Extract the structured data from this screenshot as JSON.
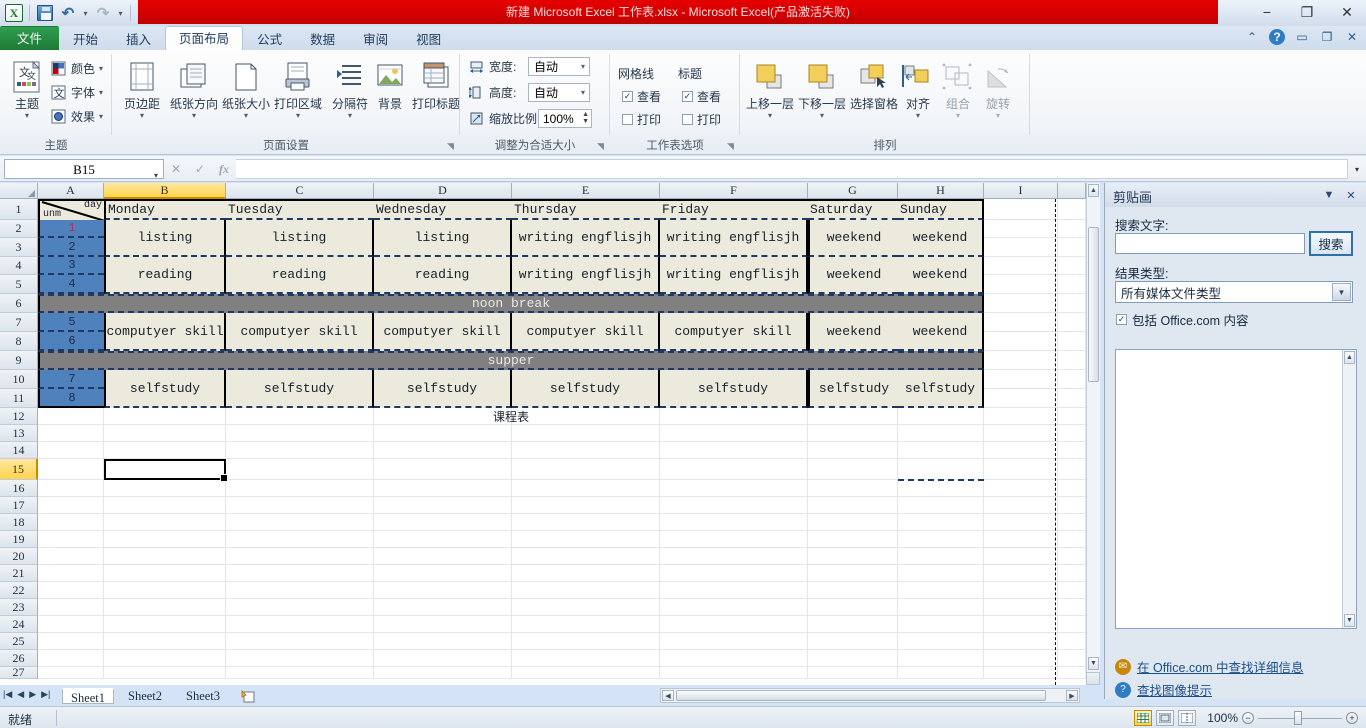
{
  "window": {
    "title": "新建 Microsoft Excel 工作表.xlsx - Microsoft Excel(产品激活失败)",
    "minimize": "−",
    "maximize": "❐",
    "close": "✕"
  },
  "quick_access": {
    "logo": "X",
    "save": "save-icon",
    "undo": "↶",
    "redo": "↷",
    "customize": "▾"
  },
  "tabs": [
    {
      "label": "文件",
      "active": false,
      "file": true
    },
    {
      "label": "开始",
      "active": false
    },
    {
      "label": "插入",
      "active": false
    },
    {
      "label": "页面布局",
      "active": true
    },
    {
      "label": "公式",
      "active": false
    },
    {
      "label": "数据",
      "active": false
    },
    {
      "label": "审阅",
      "active": false
    },
    {
      "label": "视图",
      "active": false
    }
  ],
  "ribbon": {
    "groups": [
      {
        "name": "主题"
      },
      {
        "name": "页面设置"
      },
      {
        "name": "调整为合适大小"
      },
      {
        "name": "工作表选项"
      },
      {
        "name": "排列"
      }
    ],
    "themes": {
      "theme_label": "主题",
      "colors_label": "颜色",
      "fonts_label": "字体",
      "effects_label": "效果"
    },
    "page_setup": [
      {
        "label": "页边距",
        "caret": "▾"
      },
      {
        "label": "纸张方向",
        "caret": "▾"
      },
      {
        "label": "纸张大小",
        "caret": "▾"
      },
      {
        "label": "打印区域",
        "caret": "▾"
      },
      {
        "label": "分隔符",
        "caret": "▾"
      },
      {
        "label": "背景",
        "caret": ""
      },
      {
        "label": "打印标题",
        "caret": ""
      }
    ],
    "scale_to_fit": {
      "width_label": "宽度:",
      "width_value": "自动",
      "height_label": "高度:",
      "height_value": "自动",
      "scale_label": "缩放比例:",
      "scale_value": "100%"
    },
    "sheet_options": {
      "gridlines_label": "网格线",
      "headings_label": "标题",
      "view_label": "查看",
      "print_label": "打印",
      "gridlines_view_checked": true,
      "gridlines_print_checked": false,
      "headings_view_checked": true,
      "headings_print_checked": false
    },
    "arrange": [
      {
        "label": "上移一层",
        "caret": "▾",
        "disabled": false
      },
      {
        "label": "下移一层",
        "caret": "▾",
        "disabled": false
      },
      {
        "label": "选择窗格",
        "caret": "",
        "disabled": false
      },
      {
        "label": "对齐",
        "caret": "▾",
        "disabled": false
      },
      {
        "label": "组合",
        "caret": "▾",
        "disabled": true
      },
      {
        "label": "旋转",
        "caret": "▾",
        "disabled": true
      }
    ]
  },
  "formula_bar": {
    "name_box": "B15",
    "formula_value": "",
    "fx_label": "fx"
  },
  "sheet": {
    "columns": [
      "A",
      "B",
      "C",
      "D",
      "E",
      "F",
      "G",
      "H",
      "I"
    ],
    "selected_column": "B",
    "selected_row": "15",
    "selected_cell": "B15",
    "rows": [
      "1",
      "2",
      "3",
      "4",
      "5",
      "6",
      "7",
      "8",
      "9",
      "10",
      "11",
      "12",
      "13",
      "14",
      "15",
      "16",
      "17",
      "18",
      "19",
      "20",
      "21",
      "22",
      "23",
      "24",
      "25",
      "26",
      "27"
    ],
    "corner_cell": {
      "left_text": "unm",
      "right_text": "day"
    },
    "day_headers": [
      "Monday",
      "Tuesday",
      "Wednesday",
      "Thursday",
      "Friday",
      "Saturday",
      "Sunday"
    ],
    "period_numbers": [
      "1",
      "2",
      "3",
      "4",
      "5",
      "6",
      "7",
      "8"
    ],
    "schedule": [
      {
        "period_rows": [
          "1",
          "2"
        ],
        "cells": [
          "listing",
          "listing",
          "listing",
          "writing engflisjh",
          "writing engflisjh",
          "weekend",
          "weekend"
        ]
      },
      {
        "period_rows": [
          "3",
          "4"
        ],
        "cells": [
          "reading",
          "reading",
          "reading",
          "writing engflisjh",
          "writing engflisjh",
          "weekend",
          "weekend"
        ]
      },
      {
        "period_rows": [
          "5",
          "6"
        ],
        "cells": [
          "computyer skill",
          "computyer skill",
          "computyer skill",
          "computyer skill",
          "computyer skill",
          "weekend",
          "weekend"
        ]
      },
      {
        "period_rows": [
          "7",
          "8"
        ],
        "cells": [
          "selfstudy",
          "selfstudy",
          "selfstudy",
          "selfstudy",
          "selfstudy",
          "selfstudy",
          "selfstudy"
        ]
      }
    ],
    "breaks": [
      {
        "label": "noon break",
        "after_group": 1
      },
      {
        "label": "supper",
        "after_group": 2
      }
    ],
    "caption": "课程表"
  },
  "clip_art_pane": {
    "title": "剪贴画",
    "dropdown_icon": "▼",
    "close_icon": "✕",
    "search_label": "搜索文字:",
    "search_value": "",
    "search_button": "搜索",
    "result_type_label": "结果类型:",
    "result_type_value": "所有媒体文件类型",
    "include_office_label": "包括 Office.com 内容",
    "include_office_checked": true,
    "links": [
      {
        "text": "在 Office.com 中查找详细信息",
        "icon": "globe-icon",
        "color": "#c8860d"
      },
      {
        "text": "查找图像提示",
        "icon": "help-icon",
        "color": "#2e7cc4"
      }
    ]
  },
  "sheet_tabs": {
    "tabs": [
      "Sheet1",
      "Sheet2",
      "Sheet3"
    ],
    "active": "Sheet1",
    "nav_first": "|◀",
    "nav_prev": "◀",
    "nav_next": "▶",
    "nav_last": "▶|",
    "insert_sheet": "new-sheet-icon"
  },
  "status_bar": {
    "status": "就绪",
    "zoom": "100%",
    "zoom_out": "−",
    "zoom_in": "+",
    "views": [
      "normal-view",
      "page-layout-view",
      "page-break-view"
    ]
  },
  "colors": {
    "title_red": "#d70000",
    "file_tab_green": "#1e7a36",
    "selected_header": "#ffd34d",
    "table_body": "#ece9dd",
    "period_blue": "#4f81bd",
    "break_gray": "#808080",
    "border_dash_blue": "#1f3864"
  }
}
